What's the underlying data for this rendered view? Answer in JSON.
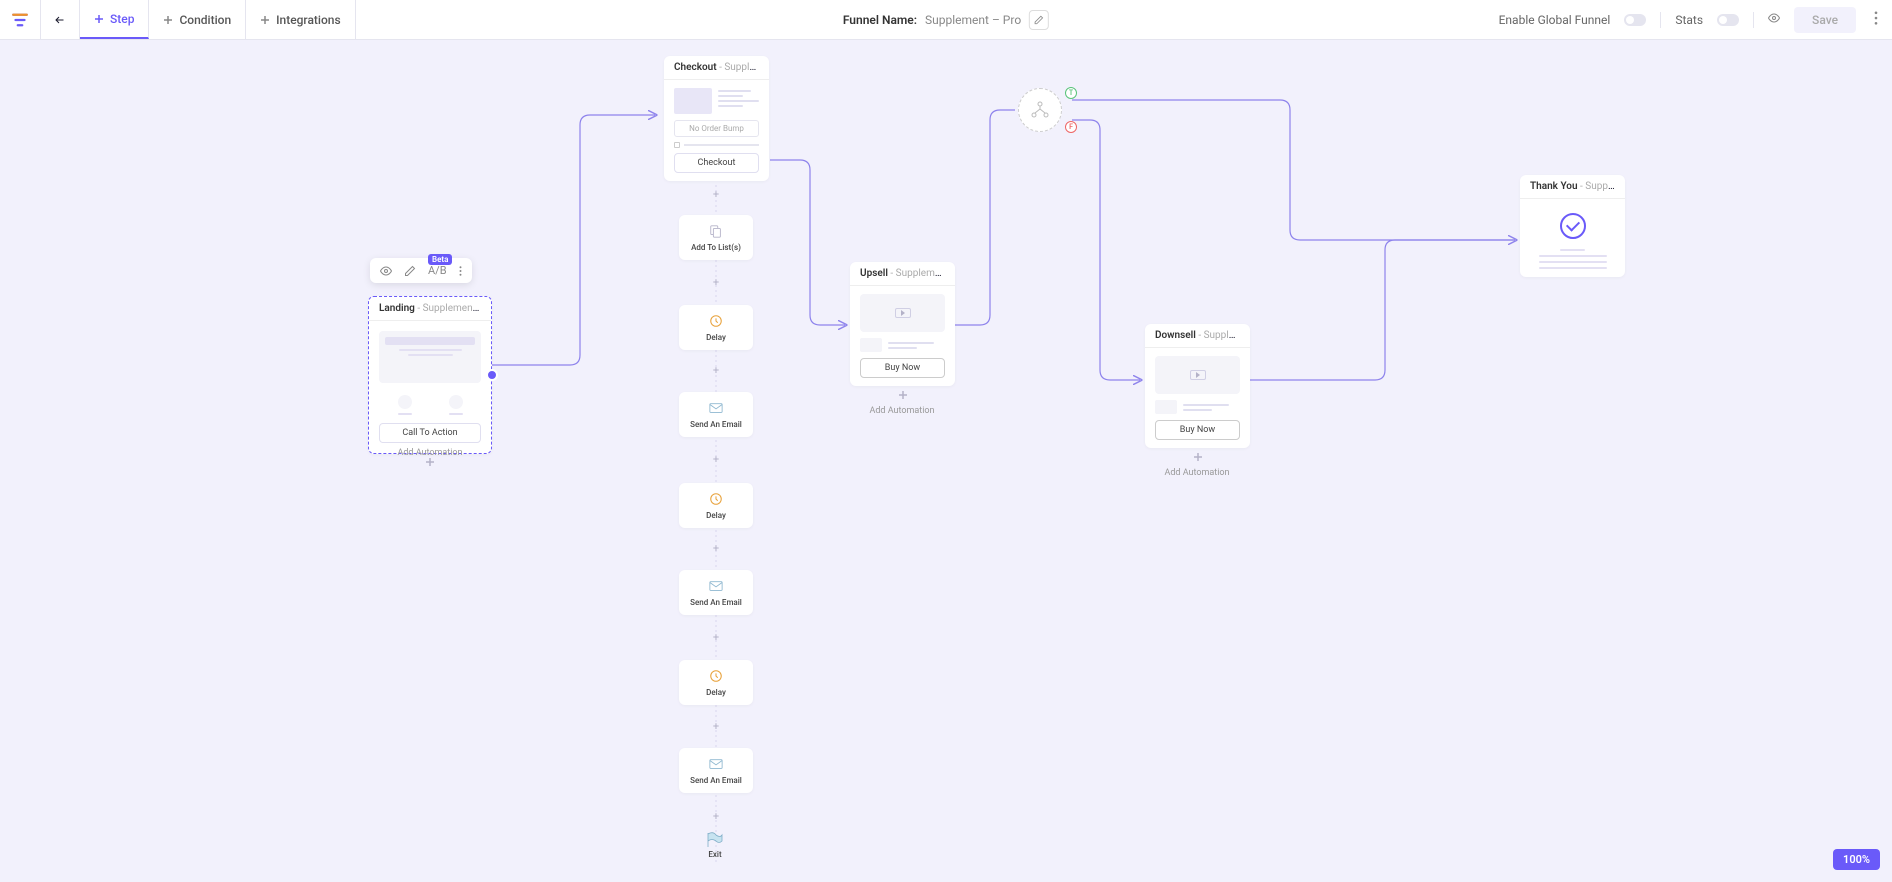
{
  "header": {
    "tabs": {
      "step": "Step",
      "condition": "Condition",
      "integrations": "Integrations"
    },
    "funnel_name_label": "Funnel Name:",
    "funnel_name_value": "Supplement – Pro",
    "enable_global": "Enable Global Funnel",
    "stats": "Stats",
    "save": "Save"
  },
  "toolbar": {
    "ab": "A/B",
    "beta": "Beta"
  },
  "landing": {
    "title": "Landing",
    "subtitle": "- Supplement La...",
    "cta": "Call To Action",
    "add_auto": "Add Automation"
  },
  "checkout": {
    "title": "Checkout",
    "subtitle": "- Supplement C...",
    "no_bump": "No Order Bump",
    "checkout_btn": "Checkout"
  },
  "automations": {
    "add_list": "Add To List(s)",
    "delay": "Delay",
    "send_email": "Send An Email",
    "exit": "Exit"
  },
  "upsell": {
    "title": "Upsell",
    "subtitle": "- Supplement U...",
    "buy": "Buy Now",
    "add_auto": "Add Automation"
  },
  "condition": {
    "t": "T",
    "f": "F"
  },
  "downsell": {
    "title": "Downsell",
    "subtitle": "- Supplement D...",
    "buy": "Buy Now",
    "add_auto": "Add Automation"
  },
  "thankyou": {
    "title": "Thank You",
    "subtitle": "- Supplement T..."
  },
  "zoom": "100%"
}
